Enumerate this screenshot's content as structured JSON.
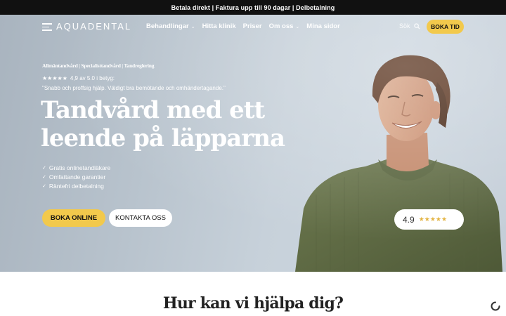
{
  "topbar": {
    "text": "Betala direkt | Faktura upp till 90 dagar | Delbetalning"
  },
  "header": {
    "logo": "AQUADENTAL",
    "nav": [
      {
        "label": "Behandlingar",
        "dropdown": true
      },
      {
        "label": "Hitta klinik",
        "dropdown": false
      },
      {
        "label": "Priser",
        "dropdown": false
      },
      {
        "label": "Om oss",
        "dropdown": true
      },
      {
        "label": "Mina sidor",
        "dropdown": false
      }
    ],
    "search_label": "Sök",
    "cta_label": "BOKA TID"
  },
  "hero": {
    "breadcrumb": "Allmäntandvård | Specialisttandvård | Tandreglering",
    "rating_stars": "★★★★★",
    "rating_text": "4,9 av 5.0 i betyg:",
    "quote": "\"Snabb och proffsig hjälp. Väldigt bra bemötande och omhändertagande.\"",
    "headline_line1": "Tandvård med ett",
    "headline_line2": "leende på läpparna",
    "features": [
      "Gratis onlinetandläkare",
      "Omfattande garantier",
      "Räntefri delbetalning"
    ],
    "primary_cta": "BOKA ONLINE",
    "secondary_cta": "KONTAKTA OSS",
    "badge_score": "4.9",
    "badge_stars": "★★★★★"
  },
  "section": {
    "title": "Hur kan vi hjälpa dig?"
  },
  "colors": {
    "accent": "#f2c94c",
    "topbar": "#111111",
    "sky": "#c4ced8",
    "sweater": "#5f6b44"
  }
}
